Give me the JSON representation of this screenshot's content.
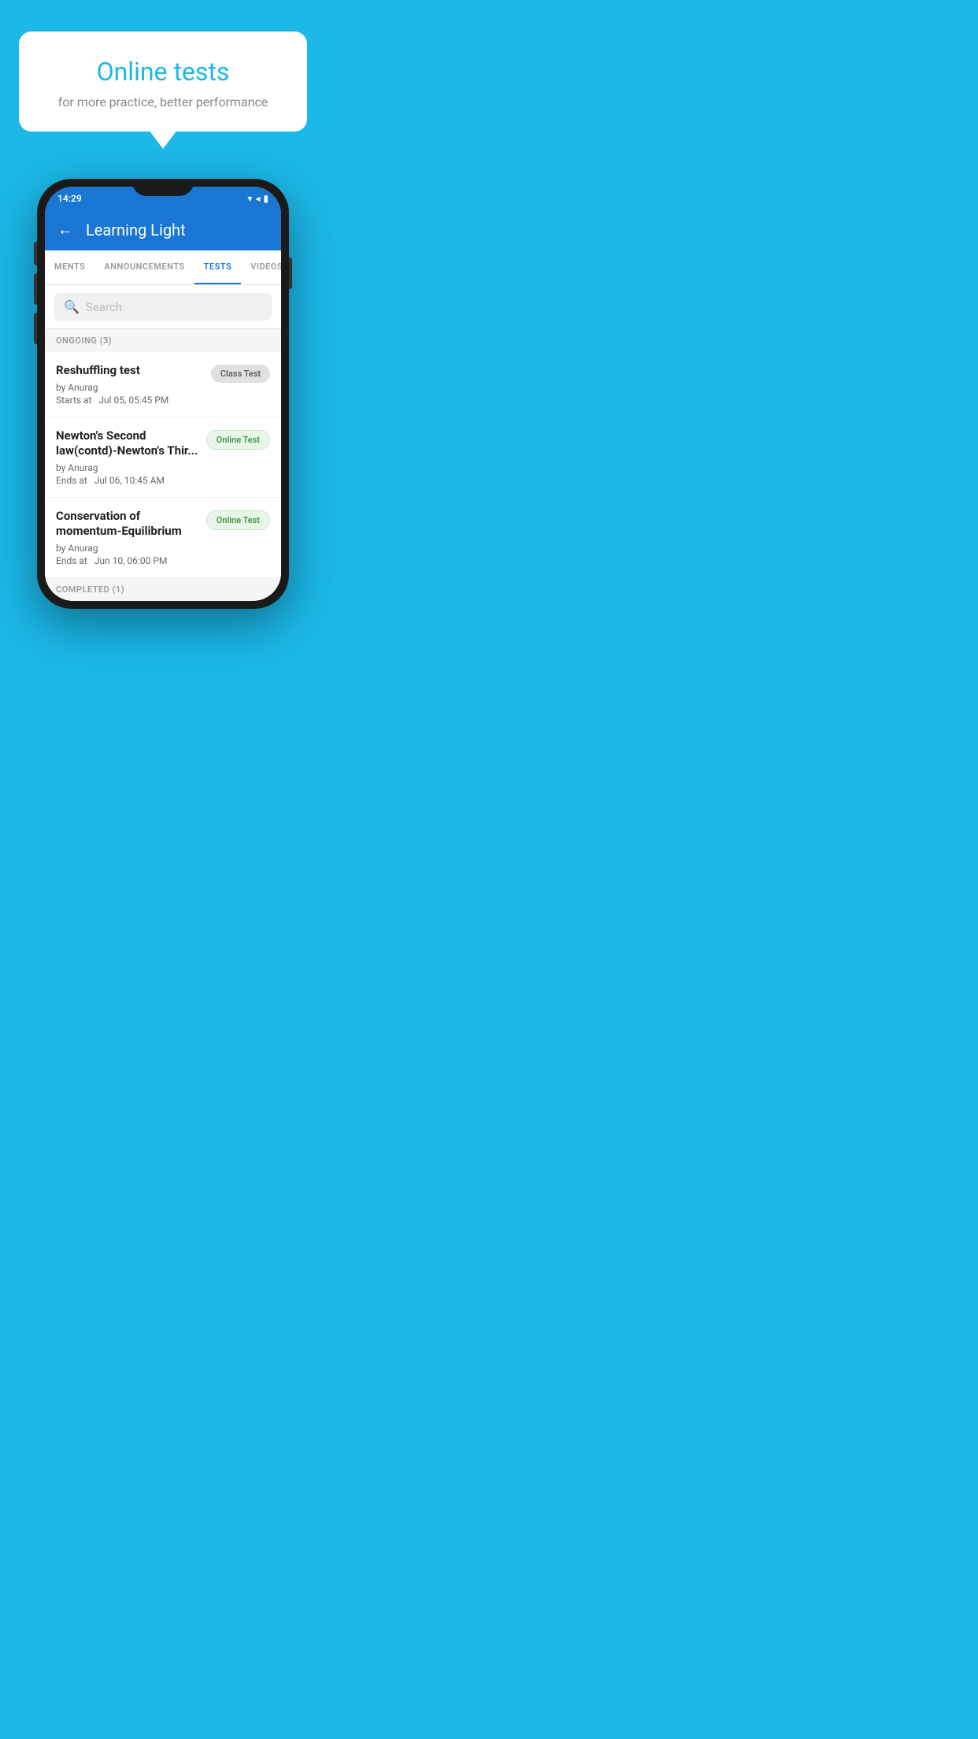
{
  "background": {
    "color": "#1BB8E8"
  },
  "speech_bubble": {
    "title": "Online tests",
    "subtitle": "for more practice, better performance"
  },
  "phone": {
    "status_bar": {
      "time": "14:29",
      "icons": "▼◂▮"
    },
    "app_bar": {
      "back_label": "←",
      "title": "Learning Light"
    },
    "tabs": [
      {
        "label": "MENTS",
        "active": false
      },
      {
        "label": "ANNOUNCEMENTS",
        "active": false
      },
      {
        "label": "TESTS",
        "active": true
      },
      {
        "label": "VIDEOS",
        "active": false
      }
    ],
    "search": {
      "placeholder": "Search"
    },
    "ongoing_section": {
      "header": "ONGOING (3)",
      "items": [
        {
          "name": "Reshuffling test",
          "by": "by Anurag",
          "date": "Starts at  Jul 05, 05:45 PM",
          "badge": "Class Test",
          "badge_type": "class"
        },
        {
          "name": "Newton's Second law(contd)-Newton's Thir...",
          "by": "by Anurag",
          "date": "Ends at  Jul 06, 10:45 AM",
          "badge": "Online Test",
          "badge_type": "online"
        },
        {
          "name": "Conservation of momentum-Equilibrium",
          "by": "by Anurag",
          "date": "Ends at  Jun 10, 06:00 PM",
          "badge": "Online Test",
          "badge_type": "online"
        }
      ]
    },
    "completed_section": {
      "header": "COMPLETED (1)"
    }
  }
}
